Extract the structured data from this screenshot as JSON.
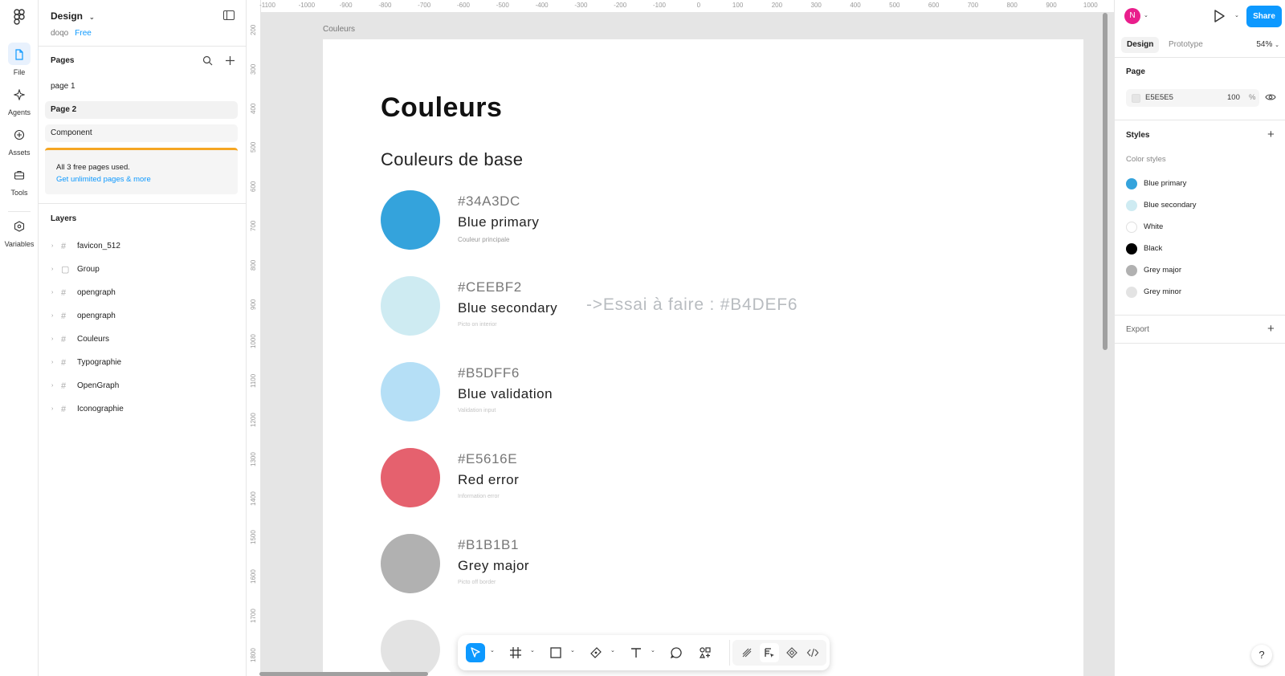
{
  "rail": {
    "items": [
      {
        "label": "File"
      },
      {
        "label": "Agents"
      },
      {
        "label": "Assets"
      },
      {
        "label": "Tools"
      },
      {
        "label": "Variables"
      }
    ]
  },
  "left_panel": {
    "file_title": "Design",
    "team": "doqo",
    "plan": "Free",
    "pages_label": "Pages",
    "pages": [
      {
        "name": "page 1"
      },
      {
        "name": "Page 2"
      },
      {
        "name": "Component"
      }
    ],
    "upsell_text": "All 3 free pages used.",
    "upsell_link": "Get unlimited pages & more",
    "layers_label": "Layers",
    "layers": [
      {
        "name": "favicon_512",
        "icon": "frame-icon"
      },
      {
        "name": "Group",
        "icon": "group-icon"
      },
      {
        "name": "opengraph",
        "icon": "frame-icon"
      },
      {
        "name": "opengraph",
        "icon": "frame-icon"
      },
      {
        "name": "Couleurs",
        "icon": "frame-icon"
      },
      {
        "name": "Typographie",
        "icon": "frame-icon"
      },
      {
        "name": "OpenGraph",
        "icon": "frame-icon"
      },
      {
        "name": "Iconographie",
        "icon": "frame-icon"
      }
    ]
  },
  "rulers": {
    "top": [
      "-1100",
      "-1000",
      "-900",
      "-800",
      "-700",
      "-600",
      "-500",
      "-400",
      "-300",
      "-200",
      "-100",
      "0",
      "100",
      "200",
      "300",
      "400",
      "500",
      "600",
      "700",
      "800",
      "900",
      "1000"
    ],
    "left": [
      "200",
      "300",
      "400",
      "500",
      "600",
      "700",
      "800",
      "900",
      "1000",
      "1100",
      "1200",
      "1300",
      "1400",
      "1500",
      "1600",
      "1700",
      "1800"
    ]
  },
  "canvas": {
    "frame_label": "Couleurs",
    "title": "Couleurs",
    "subtitle": "Couleurs de base",
    "note": "->Essai à faire : #B4DEF6",
    "colors": [
      {
        "hex": "#34A3DC",
        "name": "Blue primary",
        "desc": "Couleur principale",
        "color": "#34A3DC"
      },
      {
        "hex": "#CEEBF2",
        "name": "Blue secondary",
        "desc": "Picto on interior",
        "color": "#CEEBF2"
      },
      {
        "hex": "#B5DFF6",
        "name": "Blue validation",
        "desc": "Validation input",
        "color": "#B5DFF6"
      },
      {
        "hex": "#E5616E",
        "name": "Red error",
        "desc": "Information error",
        "color": "#E5616E"
      },
      {
        "hex": "#B1B1B1",
        "name": "Grey major",
        "desc": "Picto off border",
        "color": "#B1B1B1"
      },
      {
        "hex": "",
        "name": "",
        "desc": "",
        "color": "#E3E3E3"
      }
    ]
  },
  "toolbar": {
    "tools": [
      "move-icon",
      "frame-tool-icon",
      "rectangle-icon",
      "pen-icon",
      "text-icon",
      "comment-icon",
      "actions-icon"
    ],
    "modes": [
      "draw-mode-icon",
      "design-mode-icon",
      "component-icon",
      "dev-mode-icon"
    ]
  },
  "right_panel": {
    "avatar_initial": "N",
    "share_label": "Share",
    "tab_design": "Design",
    "tab_prototype": "Prototype",
    "zoom": "54%",
    "page_label": "Page",
    "page_fill_hex": "E5E5E5",
    "page_fill_opacity": "100",
    "page_fill_percent": "%",
    "styles_label": "Styles",
    "color_styles_label": "Color styles",
    "color_styles": [
      {
        "name": "Blue primary",
        "color": "#34A3DC"
      },
      {
        "name": "Blue secondary",
        "color": "#CEEBF2"
      },
      {
        "name": "White",
        "color": "#FFFFFF"
      },
      {
        "name": "Black",
        "color": "#000000"
      },
      {
        "name": "Grey major",
        "color": "#B1B1B1"
      },
      {
        "name": "Grey minor",
        "color": "#E3E3E3"
      }
    ],
    "export_label": "Export"
  },
  "help_label": "?"
}
